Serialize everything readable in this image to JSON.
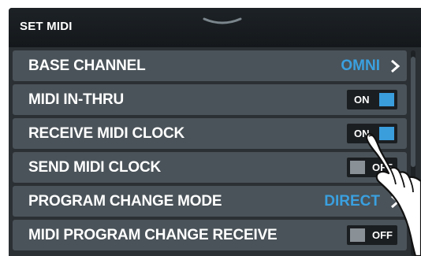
{
  "header": {
    "title": "SET MIDI",
    "handle_icon": "chevron-down-icon"
  },
  "settings": [
    {
      "label": "BASE CHANNEL",
      "kind": "select",
      "value": "OMNI",
      "icon": "chevron-right-icon"
    },
    {
      "label": "MIDI IN-THRU",
      "kind": "toggle",
      "state": "ON"
    },
    {
      "label": "RECEIVE MIDI CLOCK",
      "kind": "toggle",
      "state": "ON"
    },
    {
      "label": "SEND MIDI CLOCK",
      "kind": "toggle",
      "state": "OFF"
    },
    {
      "label": "PROGRAM CHANGE MODE",
      "kind": "select",
      "value": "DIRECT",
      "icon": "chevron-right-icon"
    },
    {
      "label": "MIDI PROGRAM CHANGE RECEIVE",
      "kind": "toggle",
      "state": "OFF"
    }
  ],
  "overlay": {
    "icon": "pointing-hand-icon"
  },
  "colors": {
    "background": "#2b3034",
    "header": "#14181b",
    "row": "#4a5359",
    "accent": "#3aa0e0",
    "toggle_off_knob": "#8a9196"
  }
}
